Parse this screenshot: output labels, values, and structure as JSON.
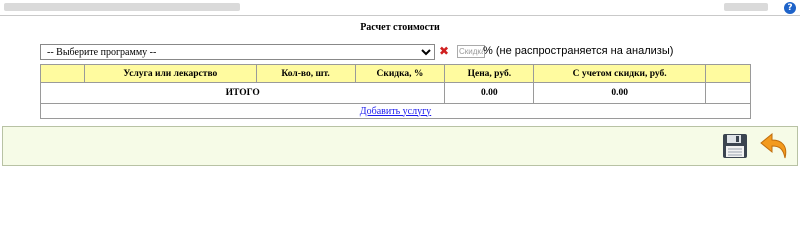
{
  "page": {
    "title": "Расчет стоимости",
    "help_symbol": "?"
  },
  "controls": {
    "program_selected": "-- Выберите программу --",
    "remove_symbol": "✖",
    "discount_placeholder": "Скидка",
    "discount_note": "% (не распространяется на анализы)"
  },
  "table": {
    "headers": [
      "",
      "Услуга или лекарство",
      "Кол-во, шт.",
      "Скидка, %",
      "Цена, руб.",
      "С учетом скидки, руб.",
      ""
    ],
    "total_label": "ИТОГО",
    "total_price": "0.00",
    "total_discounted": "0.00",
    "add_link": "Добавить услугу"
  },
  "icons": {
    "help": "help-icon",
    "remove": "remove-icon",
    "save": "floppy-disk-icon",
    "back": "return-arrow-icon"
  },
  "colors": {
    "header_bg": "#fffb9f",
    "footer_bg": "#f6fbe7",
    "link": "#1a1aee",
    "remove": "#d02020",
    "back_arrow": "#f39a1e"
  }
}
